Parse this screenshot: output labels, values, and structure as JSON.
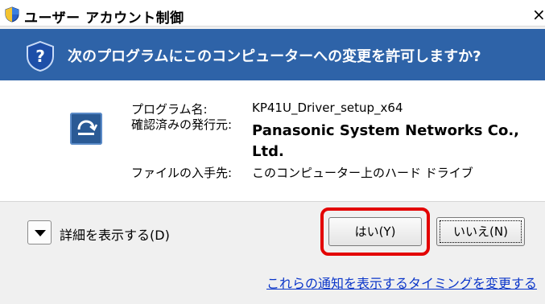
{
  "dialog": {
    "title": "ユーザー アカウント制御",
    "close_glyph": "×",
    "question": "次のプログラムにこのコンピューターへの変更を許可しますか?",
    "fields": [
      {
        "label": "プログラム名:",
        "value": "KP41U_Driver_setup_x64"
      },
      {
        "label": "確認済みの発行元:",
        "value": "Panasonic System Networks Co.,",
        "value_cont": "Ltd."
      },
      {
        "label": "ファイルの入手先:",
        "value": "このコンピューター上のハード ドライブ"
      }
    ],
    "details_label": "詳細を表示する(D)",
    "yes_label": "はい(Y)",
    "no_label": "いいえ(N)",
    "link_text": "これらの通知を表示するタイミングを変更する"
  },
  "colors": {
    "banner": "#2e63a8",
    "highlight": "#e30000",
    "link": "#0b36c9"
  },
  "icons": {
    "title_shield": "uac-shield-icon",
    "banner_shield": "question-shield-icon",
    "app": "installer-app-icon",
    "details": "chevron-down-icon"
  }
}
